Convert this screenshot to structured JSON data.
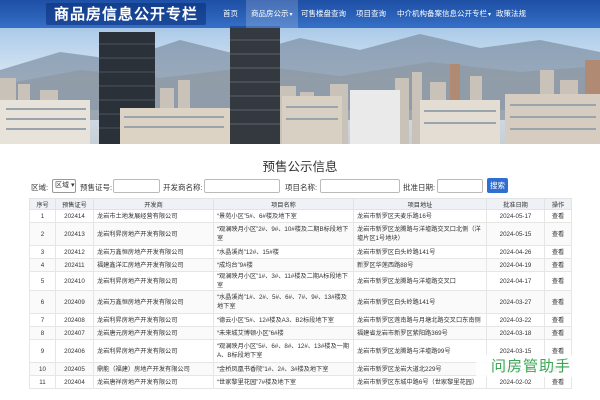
{
  "header": {
    "logo_text": "商品房信息公开专栏",
    "nav": [
      {
        "label": "首页",
        "caret": ""
      },
      {
        "label": "商品房公示",
        "caret": "▾"
      },
      {
        "label": "可售楼盘查询",
        "caret": ""
      },
      {
        "label": "项目查询",
        "caret": ""
      },
      {
        "label": "中介机构备案信息公开专栏",
        "caret": "▾"
      },
      {
        "label": "政策法规",
        "caret": ""
      }
    ]
  },
  "page_title": "预售公示信息",
  "search": {
    "district_label": "区域:",
    "district_value": "区域",
    "presale_label": "预售证号:",
    "developer_label": "开发商名称:",
    "project_label": "项目名称:",
    "approval_label": "批准日期:",
    "search_button": "搜索"
  },
  "table": {
    "headers": [
      "序号",
      "预售证号",
      "开发商",
      "项目名称",
      "项目地址",
      "批准日期",
      "操作"
    ],
    "rows": [
      {
        "no": "1",
        "cert": "202414",
        "dev": "龙岩市土地发展经营有限公司",
        "project": "“景苑小区”5#、6#楼及地下室",
        "addr": "龙岩市新罗区天麦乐路16号",
        "date": "2024-05-17",
        "op": "查看",
        "tall": false
      },
      {
        "no": "2",
        "cert": "202413",
        "dev": "龙岩利昇房地产开发有限公司",
        "project": "“观澜映月小区”2#、9#、10#楼及二期B标段地下室",
        "addr": "龙岩市新罗区龙腾路与洋墟路交叉口北侧（洋墟片区1号地块）",
        "date": "2024-05-15",
        "op": "查看",
        "tall": true
      },
      {
        "no": "3",
        "cert": "202412",
        "dev": "龙岩万鑫恒房地产开发有限公司",
        "project": "“水晶溪尚”12#、15#楼",
        "addr": "龙岩市新罗区白头岭路141号",
        "date": "2024-04-26",
        "op": "查看",
        "tall": false
      },
      {
        "no": "4",
        "cert": "202411",
        "dev": "福建鑫洋汇房地产开发有限公司",
        "project": "“成均台”9#楼",
        "addr": "新罗区华莲西路88号",
        "date": "2024-04-19",
        "op": "查看",
        "tall": false
      },
      {
        "no": "5",
        "cert": "202410",
        "dev": "龙岩利昇房地产开发有限公司",
        "project": "“观澜映月小区”1#、3#、11#楼及二期A标段地下室",
        "addr": "龙岩市新罗区龙腾路与洋墟路交叉口",
        "date": "2024-04-17",
        "op": "查看",
        "tall": false
      },
      {
        "no": "6",
        "cert": "202409",
        "dev": "龙岩万鑫恒房地产开发有限公司",
        "project": "“水晶溪尚”1#、2#、5#、6#、7#、9#、13#楼及地下室",
        "addr": "龙岩市新罗区白头岭路141号",
        "date": "2024-03-27",
        "op": "查看",
        "tall": true
      },
      {
        "no": "7",
        "cert": "202408",
        "dev": "龙岩利昇房地产开发有限公司",
        "project": "“德云小区”5#、12#楼及A3、B2标段地下室",
        "addr": "龙岩市新罗区莲南路与月塘北路交叉口东南侧",
        "date": "2024-03-22",
        "op": "查看",
        "tall": false
      },
      {
        "no": "8",
        "cert": "202407",
        "dev": "龙岩唐元房地产开发有限公司",
        "project": "“未来城艾博顿小区”6#楼",
        "addr": "福建省龙岩市新罗区紫阳路369号",
        "date": "2024-03-18",
        "op": "查看",
        "tall": false
      },
      {
        "no": "9",
        "cert": "202406",
        "dev": "龙岩利昇房地产开发有限公司",
        "project": "“观澜映月小区”5#、6#、8#、12#、13#楼及一期A、B标段地下室",
        "addr": "龙岩市新罗区龙腾路与洋墟路99号",
        "date": "2024-03-15",
        "op": "查看",
        "tall": true
      },
      {
        "no": "10",
        "cert": "202405",
        "dev": "鼎能（福建）房地产开发有限公司",
        "project": "“金桥凤凰书香院”1#、2#、3#楼及地下室",
        "addr": "龙岩市新罗区龙岩大道北229号",
        "date": "2024-01-06",
        "op": "查看",
        "tall": false
      },
      {
        "no": "11",
        "cert": "202404",
        "dev": "龙岩唐祥房地产开发有限公司",
        "project": "“世家黎里花园”7#楼及地下室",
        "addr": "龙岩市新罗区东城中路6号（世家黎里花园）",
        "date": "2024-02-02",
        "op": "查看",
        "tall": false
      }
    ]
  },
  "watermark": "问房管助手"
}
